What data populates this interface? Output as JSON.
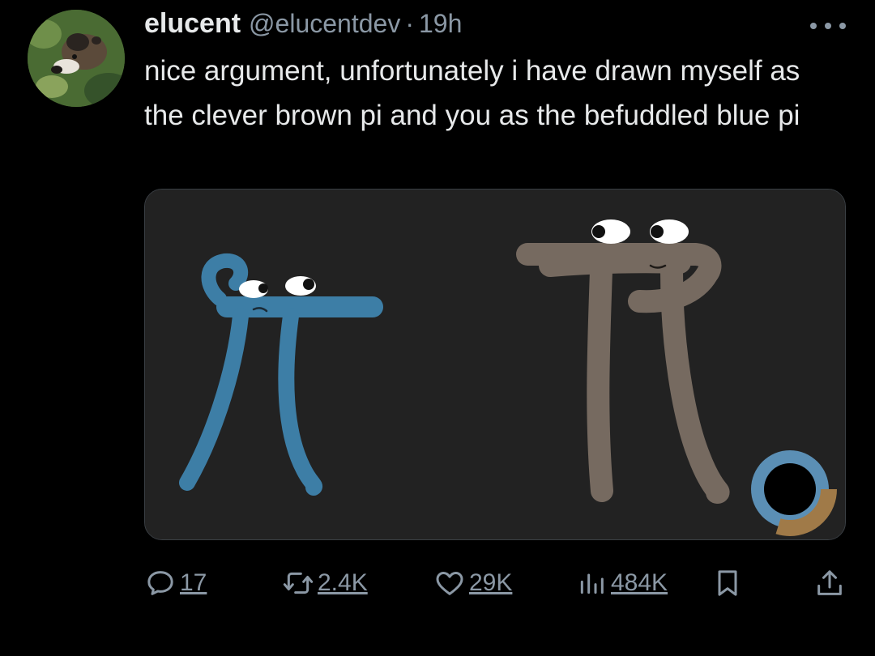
{
  "author": {
    "display_name": "elucent",
    "handle": "@elucentdev",
    "separator": "·",
    "timestamp": "19h",
    "avatar_icon": "coati-avatar"
  },
  "tweet": {
    "text": "nice argument, unfortunately i have drawn myself as the clever brown pi and you as the befuddled blue pi"
  },
  "media": {
    "blue_pi_color": "#3d7ea6",
    "brown_pi_color": "#766a60",
    "background_color": "#222222"
  },
  "actions": {
    "replies": "17",
    "reposts": "2.4K",
    "likes": "29K",
    "views": "484K",
    "icons": [
      "reply-icon",
      "repost-icon",
      "like-icon",
      "views-icon",
      "bookmark-icon",
      "share-icon"
    ]
  },
  "theme": {
    "background": "#000000",
    "text": "#e7e9ea",
    "muted": "#8b98a5"
  }
}
